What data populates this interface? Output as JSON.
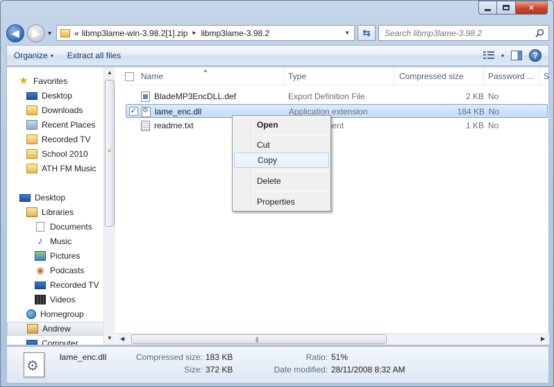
{
  "window": {
    "caption_buttons": {
      "minimize_icon": "minimize-icon",
      "maximize_icon": "maximize-icon",
      "close_glyph": "✕"
    }
  },
  "address": {
    "overflow_glyph": "«",
    "crumbs": [
      "libmp3lame-win-3.98.2[1].zip",
      "libmp3lame-3.98.2"
    ],
    "separator": "▸",
    "dropdown_glyph": "▼",
    "refresh_glyph": "⇆",
    "back_glyph": "◀",
    "forward_glyph": "▶"
  },
  "search": {
    "placeholder": "Search libmp3lame-3.98.2"
  },
  "toolbar": {
    "organize_label": "Organize",
    "extract_label": "Extract all files",
    "dropdown_glyph": "▾",
    "help_glyph": "?"
  },
  "sidebar": {
    "items": [
      {
        "label": "Favorites",
        "icon": "star-icon"
      },
      {
        "label": "Desktop",
        "icon": "monitor-icon"
      },
      {
        "label": "Downloads",
        "icon": "folder-icon"
      },
      {
        "label": "Recent Places",
        "icon": "recent-places-icon"
      },
      {
        "label": "Recorded TV",
        "icon": "folder-icon"
      },
      {
        "label": "School 2010",
        "icon": "folder-icon"
      },
      {
        "label": "ATH FM Music",
        "icon": "folder-icon"
      },
      {
        "label": "Desktop",
        "icon": "monitor-icon"
      },
      {
        "label": "Libraries",
        "icon": "library-icon"
      },
      {
        "label": "Documents",
        "icon": "document-icon"
      },
      {
        "label": "Music",
        "icon": "music-icon"
      },
      {
        "label": "Pictures",
        "icon": "picture-icon"
      },
      {
        "label": "Podcasts",
        "icon": "podcast-icon"
      },
      {
        "label": "Recorded TV",
        "icon": "monitor-icon"
      },
      {
        "label": "Videos",
        "icon": "video-icon"
      },
      {
        "label": "Homegroup",
        "icon": "homegroup-icon"
      },
      {
        "label": "Andrew",
        "icon": "user-folder-icon"
      },
      {
        "label": "Computer",
        "icon": "monitor-icon"
      }
    ]
  },
  "columns": [
    "Name",
    "Type",
    "Compressed size",
    "Password ...",
    "Si"
  ],
  "files": [
    {
      "name": "BladeMP3EncDLL.def",
      "type": "Export Definition File",
      "compressed_size": "2 KB",
      "password": "No",
      "checked": false
    },
    {
      "name": "lame_enc.dll",
      "type": "Application extension",
      "compressed_size": "184 KB",
      "password": "No",
      "checked": true
    },
    {
      "name": "readme.txt",
      "type": "Text Document",
      "compressed_size": "1 KB",
      "password": "No",
      "checked": false
    }
  ],
  "context_menu": {
    "items": [
      "Open",
      "Cut",
      "Copy",
      "Delete",
      "Properties"
    ],
    "highlighted": "Copy"
  },
  "scroll": {
    "up": "▲",
    "down": "▼",
    "left": "◀",
    "right": "▶"
  },
  "details": {
    "file_name": "lame_enc.dll",
    "compressed_size_label": "Compressed size:",
    "compressed_size": "183 KB",
    "size_label": "Size:",
    "size": "372 KB",
    "ratio_label": "Ratio:",
    "ratio": "51%",
    "date_label": "Date modified:",
    "date": "28/11/2008 8:32 AM"
  },
  "colors": {
    "accent": "#2f67b9",
    "selection": "#c1dcfc",
    "close": "#c7452b"
  }
}
